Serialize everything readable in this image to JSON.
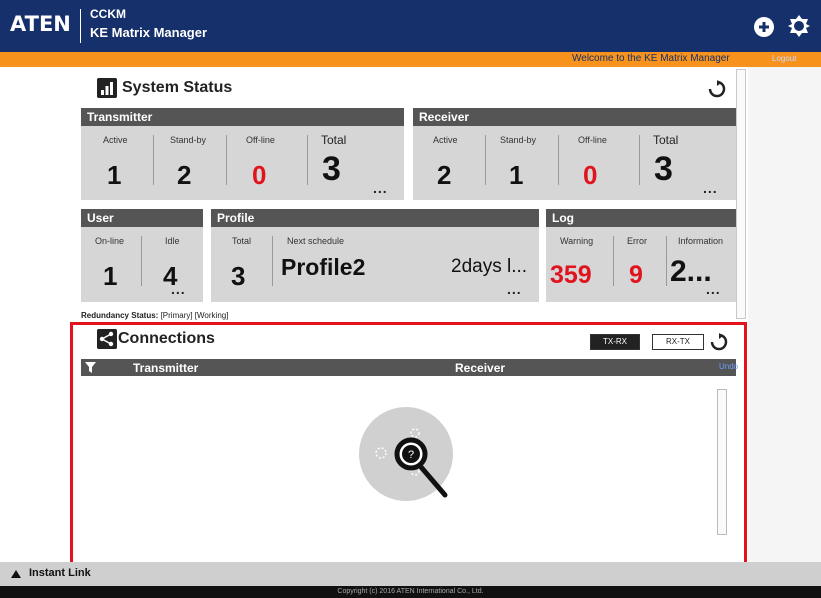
{
  "header": {
    "logo": "ATEN",
    "app_line1": "CCKM",
    "app_line2": "KE Matrix Manager",
    "icons": [
      "plus-circle-icon",
      "settings-gear-icon"
    ]
  },
  "welcome_bar": {
    "message": "Welcome to the KE Matrix Manager",
    "logout": "Logout"
  },
  "system_status": {
    "title": "System Status",
    "transmitter": {
      "title": "Transmitter",
      "active_label": "Active",
      "active": "1",
      "standby_label": "Stand-by",
      "standby": "2",
      "offline_label": "Off-line",
      "offline": "0",
      "total_label": "Total",
      "total": "3"
    },
    "receiver": {
      "title": "Receiver",
      "active_label": "Active",
      "active": "2",
      "standby_label": "Stand-by",
      "standby": "1",
      "offline_label": "Off-line",
      "offline": "0",
      "total_label": "Total",
      "total": "3"
    },
    "user": {
      "title": "User",
      "online_label": "On-line",
      "online": "1",
      "idle_label": "Idle",
      "idle": "4"
    },
    "profile": {
      "title": "Profile",
      "total_label": "Total",
      "total": "3",
      "next_label": "Next schedule",
      "next_value": "Profile2",
      "next_time": "2days l..."
    },
    "log": {
      "title": "Log",
      "warning_label": "Warning",
      "warning": "359",
      "error_label": "Error",
      "error": "9",
      "info_label": "Information",
      "info": "2..."
    },
    "more": "..."
  },
  "redundancy": {
    "label": "Redundancy Status:",
    "value": "[Primary] [Working]"
  },
  "connections": {
    "title": "Connections",
    "tx_rx": "TX-RX",
    "rx_tx": "RX-TX",
    "col_transmitter": "Transmitter",
    "col_receiver": "Receiver",
    "undo": "Undo"
  },
  "instant_link": "Instant Link",
  "footer": "Copyright (c) 2016 ATEN International Co., Ltd.",
  "colors": {
    "header": "#15306b",
    "welcome": "#f7931d",
    "highlight": "#e3121c",
    "alert_red": "#e0141e"
  }
}
